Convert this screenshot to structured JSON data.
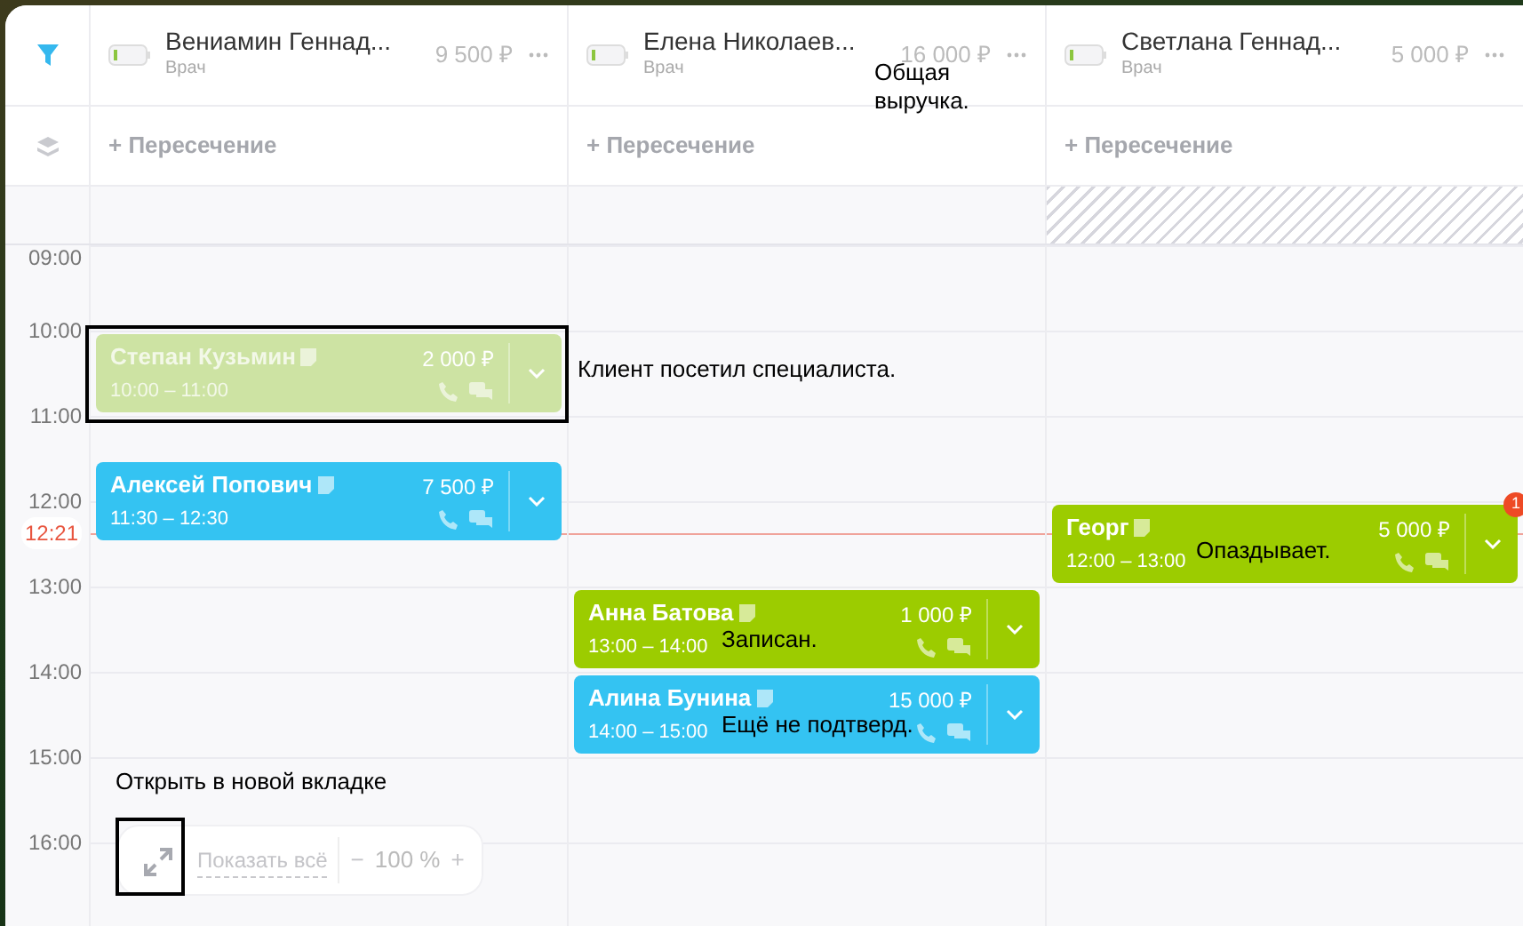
{
  "staff": [
    {
      "name": "Вениамин Геннад...",
      "role": "Врач",
      "revenue": "9 500 ₽",
      "intersection": "+ Пересечение",
      "blocked": false,
      "events": [
        {
          "name": "Степан Кузьмин",
          "time": "10:00 – 11:00",
          "price": "2 000 ₽",
          "color": "#cde3a3",
          "visited": true
        },
        {
          "name": "Алексей Попович",
          "time": "11:30 – 12:30",
          "price": "7 500 ₽",
          "color": "#34c3f2",
          "visited": false
        }
      ]
    },
    {
      "name": "Елена Николаев...",
      "role": "Врач",
      "revenue": "16 000 ₽",
      "intersection": "+ Пересечение",
      "blocked": false,
      "events": [
        {
          "name": "Анна Батова",
          "time": "13:00 – 14:00",
          "price": "1 000 ₽",
          "color": "#9ccc00",
          "visited": false
        },
        {
          "name": "Алина Бунина",
          "time": "14:00 – 15:00",
          "price": "15 000 ₽",
          "color": "#34c3f2",
          "visited": false
        }
      ]
    },
    {
      "name": "Светлана Геннад...",
      "role": "Врач",
      "revenue": "5 000 ₽",
      "intersection": "+ Пересечение",
      "blocked": true,
      "events": [
        {
          "name": "Георг",
          "time": "12:00 – 13:00",
          "price": "5 000 ₽",
          "color": "#9ccc00",
          "visited": false,
          "badge": "1"
        }
      ]
    }
  ],
  "hours": [
    "09:00",
    "10:00",
    "11:00",
    "12:00",
    "13:00",
    "14:00",
    "15:00",
    "16:00"
  ],
  "now": "12:21",
  "toolbar": {
    "show_all": "Показать всё",
    "minus": "−",
    "zoom": "100 %",
    "plus": "+"
  },
  "callouts": [
    {
      "kind": "revenue",
      "text": "Общая выручка."
    },
    {
      "kind": "visited",
      "text": "Клиент посетил специалиста."
    },
    {
      "kind": "late",
      "text": "Опаздывает."
    },
    {
      "kind": "booked",
      "text": "Записан."
    },
    {
      "kind": "unconfirmed",
      "text": "Ещё не подтверд."
    },
    {
      "kind": "newtab",
      "text": "Открыть в новой вкладке"
    }
  ]
}
